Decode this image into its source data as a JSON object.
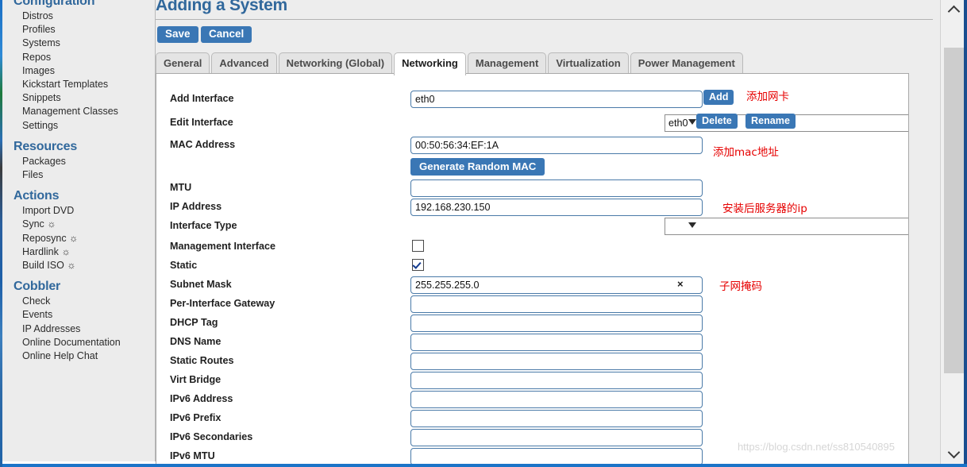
{
  "sidebar": {
    "sections": [
      {
        "heading": "Configuration",
        "items": [
          "Distros",
          "Profiles",
          "Systems",
          "Repos",
          "Images",
          "Kickstart Templates",
          "Snippets",
          "Management Classes",
          "Settings"
        ]
      },
      {
        "heading": "Resources",
        "items": [
          "Packages",
          "Files"
        ]
      },
      {
        "heading": "Actions",
        "items": [
          "Import DVD",
          "Sync ☼",
          "Reposync ☼",
          "Hardlink ☼",
          "Build ISO ☼"
        ]
      },
      {
        "heading": "Cobbler",
        "items": [
          "Check",
          "Events",
          "IP Addresses",
          "Online Documentation",
          "Online Help Chat"
        ]
      }
    ]
  },
  "page": {
    "title": "Adding a System",
    "save_label": "Save",
    "cancel_label": "Cancel"
  },
  "tabs": [
    {
      "label": "General",
      "active": false
    },
    {
      "label": "Advanced",
      "active": false
    },
    {
      "label": "Networking (Global)",
      "active": false
    },
    {
      "label": "Networking",
      "active": true
    },
    {
      "label": "Management",
      "active": false
    },
    {
      "label": "Virtualization",
      "active": false
    },
    {
      "label": "Power Management",
      "active": false
    }
  ],
  "form": {
    "add_interface": {
      "label": "Add Interface",
      "value": "eth0",
      "button": "Add"
    },
    "edit_interface": {
      "label": "Edit Interface",
      "value": "eth0",
      "options": [
        "eth0"
      ],
      "delete_button": "Delete",
      "rename_button": "Rename"
    },
    "mac_address": {
      "label": "MAC Address",
      "value": "00:50:56:34:EF:1A"
    },
    "generate_mac_button": "Generate Random MAC",
    "mtu": {
      "label": "MTU",
      "value": ""
    },
    "ip_address": {
      "label": "IP Address",
      "value": "192.168.230.150"
    },
    "interface_type": {
      "label": "Interface Type",
      "value": "",
      "options": [
        ""
      ]
    },
    "management_interface": {
      "label": "Management Interface",
      "checked": false
    },
    "static": {
      "label": "Static",
      "checked": true
    },
    "subnet_mask": {
      "label": "Subnet Mask",
      "value": "255.255.255.0",
      "clear_icon": "×"
    },
    "per_interface_gateway": {
      "label": "Per-Interface Gateway",
      "value": ""
    },
    "dhcp_tag": {
      "label": "DHCP Tag",
      "value": ""
    },
    "dns_name": {
      "label": "DNS Name",
      "value": ""
    },
    "static_routes": {
      "label": "Static Routes",
      "value": ""
    },
    "virt_bridge": {
      "label": "Virt Bridge",
      "value": ""
    },
    "ipv6_address": {
      "label": "IPv6 Address",
      "value": ""
    },
    "ipv6_prefix": {
      "label": "IPv6 Prefix",
      "value": ""
    },
    "ipv6_secondaries": {
      "label": "IPv6 Secondaries",
      "value": ""
    },
    "ipv6_mtu": {
      "label": "IPv6 MTU",
      "value": ""
    }
  },
  "annotations": {
    "add_nic": "添加网卡",
    "add_mac": "添加mac地址",
    "server_ip": "安装后服务器的ip",
    "subnet_mask": "子网掩码"
  },
  "watermark": "https://blog.csdn.net/ss810540895",
  "colors": {
    "accent_blue": "#31689c",
    "button_blue": "#3a77b5",
    "annotation_red": "#e60000",
    "sidebar_bg": "#ececec",
    "panel_bg": "#ffffff"
  }
}
